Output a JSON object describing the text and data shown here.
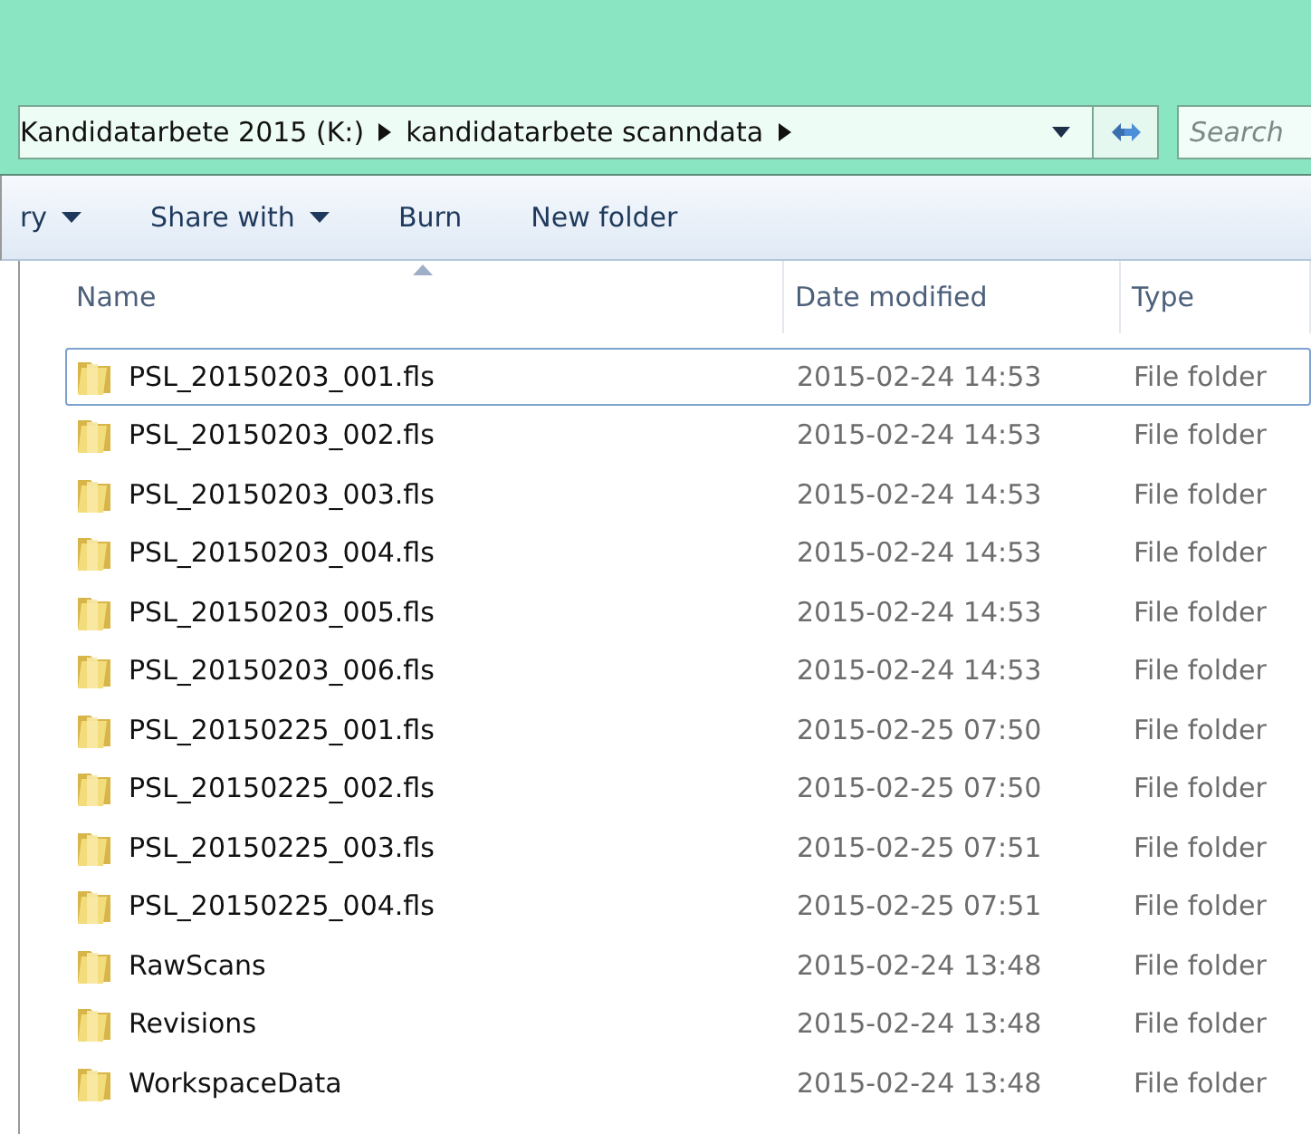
{
  "address_bar": {
    "crumbs": [
      "Kandidatarbete 2015 (K:)",
      "kandidatarbete scanndata"
    ]
  },
  "search": {
    "placeholder": "Search"
  },
  "toolbar": [
    {
      "label": "ry",
      "dropdown": true
    },
    {
      "label": "Share with",
      "dropdown": true
    },
    {
      "label": "Burn",
      "dropdown": false
    },
    {
      "label": "New folder",
      "dropdown": false
    }
  ],
  "columns": [
    {
      "label": "Name",
      "sorted": true
    },
    {
      "label": "Date modified",
      "sorted": false
    },
    {
      "label": "Type",
      "sorted": false
    }
  ],
  "rows": [
    {
      "name": "PSL_20150203_001.fls",
      "date": "2015-02-24 14:53",
      "type": "File folder",
      "focused": true
    },
    {
      "name": "PSL_20150203_002.fls",
      "date": "2015-02-24 14:53",
      "type": "File folder",
      "focused": false
    },
    {
      "name": "PSL_20150203_003.fls",
      "date": "2015-02-24 14:53",
      "type": "File folder",
      "focused": false
    },
    {
      "name": "PSL_20150203_004.fls",
      "date": "2015-02-24 14:53",
      "type": "File folder",
      "focused": false
    },
    {
      "name": "PSL_20150203_005.fls",
      "date": "2015-02-24 14:53",
      "type": "File folder",
      "focused": false
    },
    {
      "name": "PSL_20150203_006.fls",
      "date": "2015-02-24 14:53",
      "type": "File folder",
      "focused": false
    },
    {
      "name": "PSL_20150225_001.fls",
      "date": "2015-02-25 07:50",
      "type": "File folder",
      "focused": false
    },
    {
      "name": "PSL_20150225_002.fls",
      "date": "2015-02-25 07:50",
      "type": "File folder",
      "focused": false
    },
    {
      "name": "PSL_20150225_003.fls",
      "date": "2015-02-25 07:51",
      "type": "File folder",
      "focused": false
    },
    {
      "name": "PSL_20150225_004.fls",
      "date": "2015-02-25 07:51",
      "type": "File folder",
      "focused": false
    },
    {
      "name": "RawScans",
      "date": "2015-02-24 13:48",
      "type": "File folder",
      "focused": false
    },
    {
      "name": "Revisions",
      "date": "2015-02-24 13:48",
      "type": "File folder",
      "focused": false
    },
    {
      "name": "WorkspaceData",
      "date": "2015-02-24 13:48",
      "type": "File folder",
      "focused": false
    }
  ]
}
